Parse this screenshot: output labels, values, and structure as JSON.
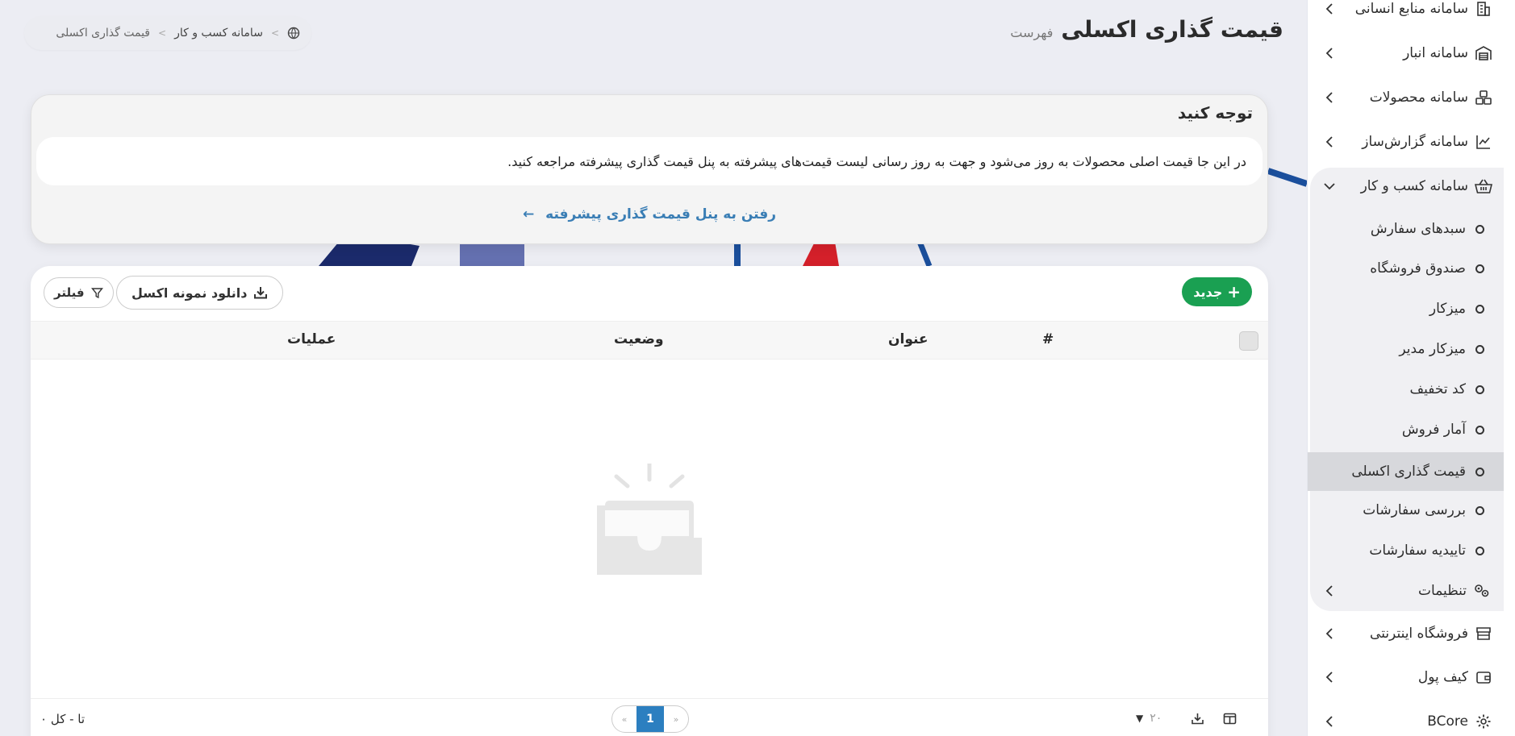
{
  "colors": {
    "accent_blue": "#2c7fc0",
    "link_blue": "#3a7eb5",
    "success_green": "#1aa052",
    "sidebar_active_bg": "#d7d8dc"
  },
  "header": {
    "title": "قیمت گذاری اکسلی",
    "subtitle": "فهرست"
  },
  "breadcrumb": {
    "icon": "globe-icon",
    "items": [
      "سامانه کسب و کار",
      "قیمت گذاری اکسلی"
    ],
    "separator": ">"
  },
  "notice": {
    "heading": "توجه کنید",
    "body": "در این جا قیمت اصلی محصولات به روز می‌شود و جهت به روز رسانی لیست قیمت‌های پیشرفته به پنل قیمت گذاری پیشرفته مراجعه کنید.",
    "link_label": "رفتن به پنل قیمت گذاری پیشرفته"
  },
  "toolbar": {
    "new_label": "جدید",
    "download_label": "دانلود نمونه اکسل",
    "filter_label": "فیلتر"
  },
  "table": {
    "columns": [
      "#",
      "عنوان",
      "وضعیت",
      "عملیات"
    ]
  },
  "footer": {
    "total_text": "تا - کل ۰",
    "per_page": "۲۰",
    "current_page": "1",
    "prev_label": "«",
    "next_label": "»"
  },
  "sidebar": {
    "items": [
      {
        "label": "سامانه منابع انسانی",
        "icon": "building-icon"
      },
      {
        "label": "سامانه انبار",
        "icon": "warehouse-icon"
      },
      {
        "label": "سامانه محصولات",
        "icon": "boxes-icon"
      },
      {
        "label": "سامانه گزارش‌ساز",
        "icon": "chart-line-icon"
      },
      {
        "label": "سامانه کسب و کار",
        "icon": "basket-icon"
      }
    ],
    "subitems": [
      {
        "label": "سبدهای سفارش"
      },
      {
        "label": "صندوق فروشگاه"
      },
      {
        "label": "میزکار"
      },
      {
        "label": "میزکار مدیر"
      },
      {
        "label": "کد تخفیف"
      },
      {
        "label": "آمار فروش"
      },
      {
        "label": "قیمت گذاری اکسلی"
      },
      {
        "label": "بررسی سفارشات"
      },
      {
        "label": "تاییدیه سفارشات"
      }
    ],
    "settings": {
      "label": "تنظیمات",
      "icon": "gears-icon"
    },
    "bottom_items": [
      {
        "label": "فروشگاه اینترنتی",
        "icon": "store-icon"
      },
      {
        "label": "کیف پول",
        "icon": "wallet-icon"
      },
      {
        "label": "BCore",
        "icon": "gear-icon"
      }
    ]
  }
}
